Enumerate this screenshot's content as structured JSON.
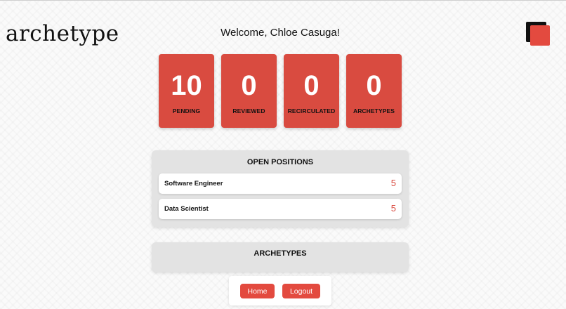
{
  "header": {
    "logo_text": "archetype",
    "welcome_text": "Welcome, Chloe Casuga!"
  },
  "stats": [
    {
      "value": "10",
      "label": "PENDING"
    },
    {
      "value": "0",
      "label": "REVIEWED"
    },
    {
      "value": "0",
      "label": "RECIRCULATED"
    },
    {
      "value": "0",
      "label": "ARCHETYPES"
    }
  ],
  "open_positions": {
    "title": "OPEN POSITIONS",
    "items": [
      {
        "name": "Software Engineer",
        "count": "5"
      },
      {
        "name": "Data Scientist",
        "count": "5"
      }
    ]
  },
  "archetypes_panel": {
    "title": "ARCHETYPES"
  },
  "nav": {
    "home_label": "Home",
    "logout_label": "Logout"
  },
  "colors": {
    "accent": "#d94b40",
    "button": "#e34a3f",
    "panel": "#e3e3e3"
  }
}
